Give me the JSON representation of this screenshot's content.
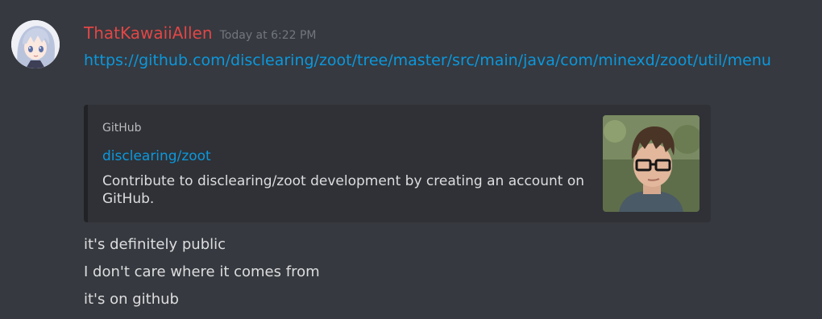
{
  "message": {
    "author": "ThatKawaiiAllen",
    "timestamp": "Today at 6:22 PM",
    "author_color": "#e24646",
    "avatar": "anime-avatar-icon",
    "link": "https://github.com/disclearing/zoot/tree/master/src/main/java/com/minexd/zoot/util/menu",
    "embed": {
      "provider": "GitHub",
      "title": "disclearing/zoot",
      "description": "Contribute to disclearing/zoot development by creating an account on GitHub.",
      "thumbnail": "user-photo-thumbnail"
    },
    "lines": [
      "it's definitely public",
      "I don't care where it comes from",
      "it's on github"
    ]
  },
  "colors": {
    "background": "#36393f",
    "link": "#0b98dd",
    "embed_background": "#2f3136",
    "text": "#dcddde",
    "muted": "#72767d"
  }
}
